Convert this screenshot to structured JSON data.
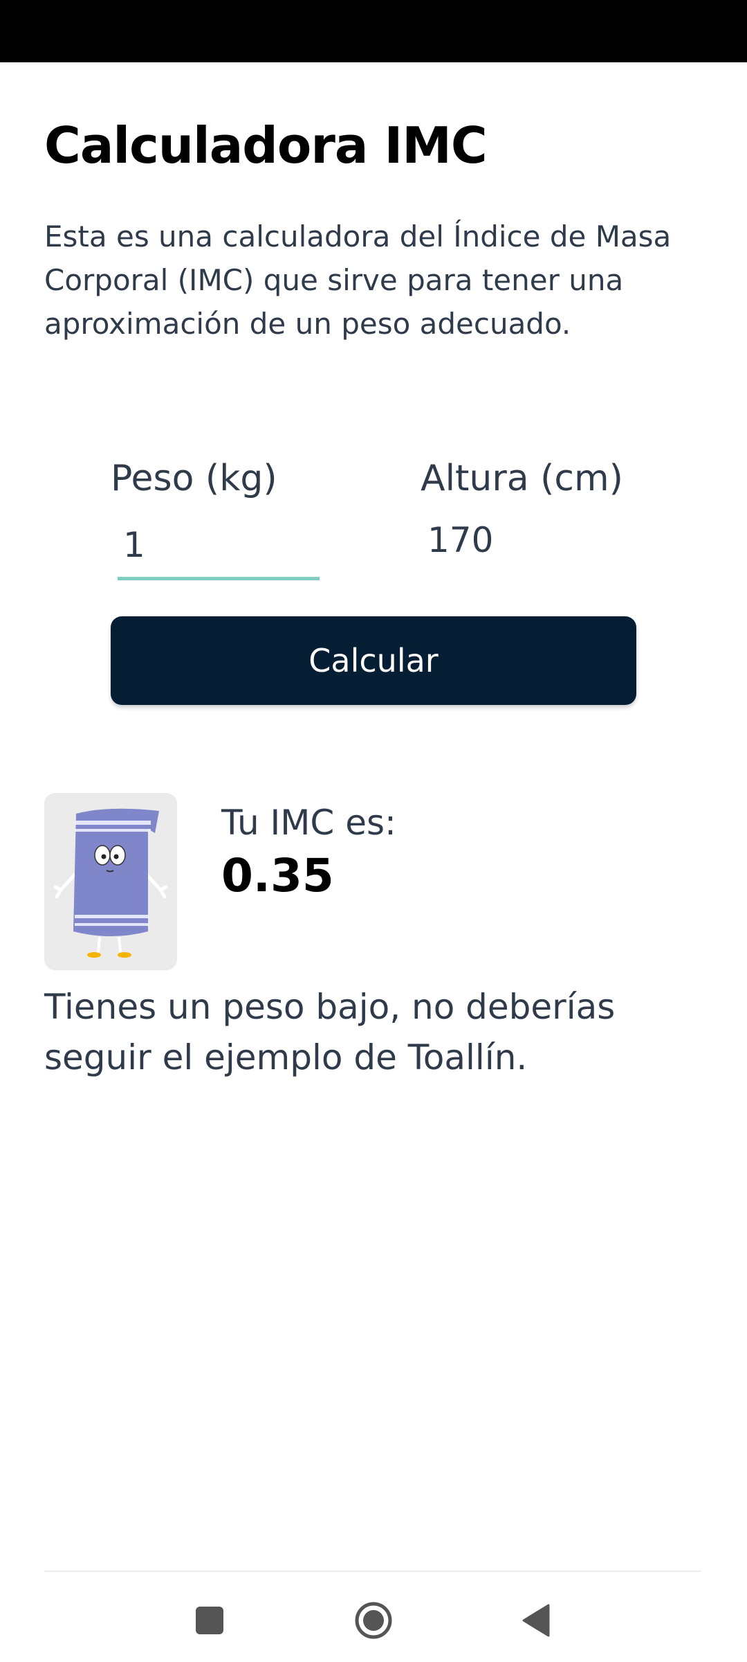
{
  "app": {
    "title": "Calculadora IMC",
    "description": "Esta es una calculadora del Índice de Masa Corporal (IMC) que sirve para tener una aproximación de un peso adecuado."
  },
  "form": {
    "weight_label": "Peso (kg)",
    "weight_value": "1",
    "height_label": "Altura (cm)",
    "height_value": "170",
    "calculate_label": "Calcular"
  },
  "result": {
    "label": "Tu IMC es:",
    "value": "0.35",
    "message": "Tienes un peso bajo, no deberías seguir el ejemplo de Toallín.",
    "image_icon": "towel-character-icon"
  },
  "nav": {
    "recents_icon": "square-icon",
    "home_icon": "circle-home-icon",
    "back_icon": "triangle-back-icon"
  },
  "colors": {
    "primary_button": "#051e33",
    "input_underline": "#7ecdbf",
    "text": "#2f3b4a",
    "status_bar": "#000000"
  }
}
